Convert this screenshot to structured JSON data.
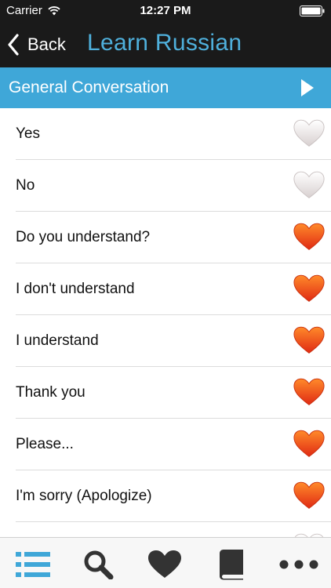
{
  "status_bar": {
    "carrier": "Carrier",
    "time": "12:27 PM",
    "wifi_icon": "wifi-icon",
    "battery_icon": "battery-icon"
  },
  "nav": {
    "back_label": "Back",
    "back_icon": "chevron-left-icon",
    "title": "Learn Russian"
  },
  "section": {
    "title": "General Conversation",
    "play_icon": "play-icon"
  },
  "phrases": [
    {
      "label": "Yes",
      "favorite": false
    },
    {
      "label": "No",
      "favorite": false
    },
    {
      "label": "Do you understand?",
      "favorite": true
    },
    {
      "label": "I don't understand",
      "favorite": true
    },
    {
      "label": "I understand",
      "favorite": true
    },
    {
      "label": "Thank you",
      "favorite": true
    },
    {
      "label": "Please...",
      "favorite": true
    },
    {
      "label": "I'm sorry (Apologize)",
      "favorite": true
    },
    {
      "label": "",
      "favorite": false
    }
  ],
  "tabs": [
    {
      "icon": "list-icon",
      "active": true
    },
    {
      "icon": "search-icon",
      "active": false
    },
    {
      "icon": "heart-icon",
      "active": false
    },
    {
      "icon": "book-icon",
      "active": false
    },
    {
      "icon": "more-icon",
      "active": false
    }
  ],
  "colors": {
    "nav_background": "#1a1a1a",
    "title_accent": "#4fb0dc",
    "section_background": "#3fa7d8",
    "favorite_heart": "#f04a1c",
    "unfavorite_heart": "#e8e4e4",
    "tab_active": "#3fa7d8",
    "tab_inactive": "#333333"
  }
}
